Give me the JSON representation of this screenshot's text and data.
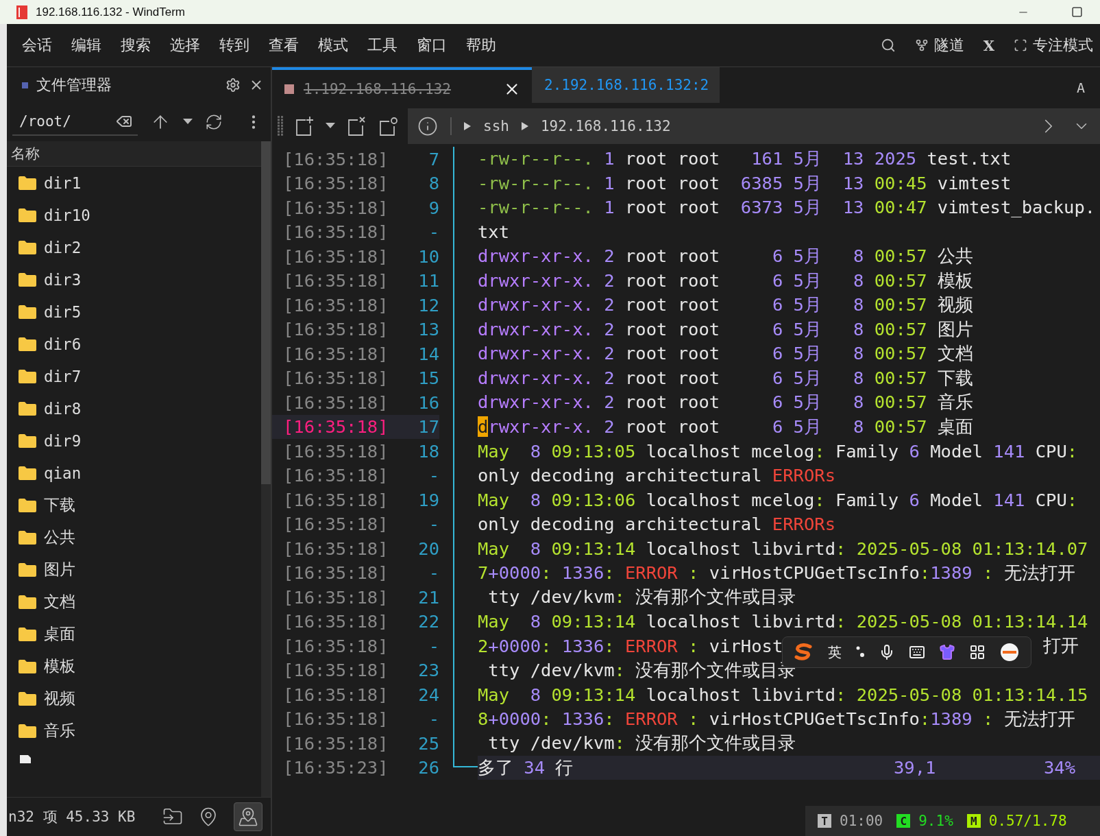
{
  "window": {
    "title": "192.168.116.132 - WindTerm"
  },
  "menu": [
    "会话",
    "编辑",
    "搜索",
    "选择",
    "转到",
    "查看",
    "模式",
    "工具",
    "窗口",
    "帮助"
  ],
  "menu_right": {
    "tunnel": "隧道",
    "x": "X",
    "focus": "专注模式"
  },
  "file_manager": {
    "title": "文件管理器",
    "path": "/root/",
    "column": "名称",
    "items": [
      {
        "kind": "folder",
        "name": "dir1"
      },
      {
        "kind": "folder",
        "name": "dir10"
      },
      {
        "kind": "folder",
        "name": "dir2"
      },
      {
        "kind": "folder",
        "name": "dir3"
      },
      {
        "kind": "folder",
        "name": "dir5"
      },
      {
        "kind": "folder",
        "name": "dir6"
      },
      {
        "kind": "folder",
        "name": "dir7"
      },
      {
        "kind": "folder",
        "name": "dir8"
      },
      {
        "kind": "folder",
        "name": "dir9"
      },
      {
        "kind": "folder",
        "name": "qian"
      },
      {
        "kind": "folder",
        "name": "下载"
      },
      {
        "kind": "folder",
        "name": "公共"
      },
      {
        "kind": "folder",
        "name": "图片"
      },
      {
        "kind": "folder",
        "name": "文档"
      },
      {
        "kind": "folder",
        "name": "桌面"
      },
      {
        "kind": "folder",
        "name": "模板"
      },
      {
        "kind": "folder",
        "name": "视频"
      },
      {
        "kind": "folder",
        "name": "音乐"
      },
      {
        "kind": "file"
      }
    ],
    "footer": "n32 项 45.33 KB",
    "footer_buttons": [
      {
        "kind": "open",
        "selected": false
      },
      {
        "kind": "locate",
        "selected": false
      },
      {
        "kind": "follow",
        "selected": true
      }
    ]
  },
  "tabs": [
    {
      "label": "1.192.168.116.132",
      "selected": true,
      "disconnected": true
    },
    {
      "label": "2.192.168.116.132:2",
      "selected": false,
      "disconnected": false
    }
  ],
  "tab_bar_right": "A",
  "breadcrumb": [
    "ssh",
    "192.168.116.132"
  ],
  "terminal": {
    "rows": [
      {
        "time": "[16:35:18]",
        "num": "7",
        "current": false,
        "segs": [
          {
            "text": "-rw-r--r--.",
            "kind": "fperm"
          },
          {
            "text": " 1",
            "kind": "num"
          },
          {
            "text": " root root",
            "kind": "plain"
          },
          {
            "text": "   161 5月  13 2025",
            "kind": "num"
          },
          {
            "text": " test.txt",
            "kind": "plain"
          }
        ]
      },
      {
        "time": "[16:35:18]",
        "num": "8",
        "current": false,
        "segs": [
          {
            "text": "-rw-r--r--.",
            "kind": "fperm"
          },
          {
            "text": " 1",
            "kind": "num"
          },
          {
            "text": " root root",
            "kind": "plain"
          },
          {
            "text": "  6385 5月  13",
            "kind": "num"
          },
          {
            "text": " 00:45",
            "kind": "lime"
          },
          {
            "text": " vimtest",
            "kind": "plain"
          }
        ]
      },
      {
        "time": "[16:35:18]",
        "num": "9",
        "current": false,
        "segs": [
          {
            "text": "-rw-r--r--.",
            "kind": "fperm"
          },
          {
            "text": " 1",
            "kind": "num"
          },
          {
            "text": " root root",
            "kind": "plain"
          },
          {
            "text": "  6373 5月  13",
            "kind": "num"
          },
          {
            "text": " 00:47",
            "kind": "lime"
          },
          {
            "text": " vimtest_backup.",
            "kind": "plain"
          }
        ]
      },
      {
        "time": "[16:35:18]",
        "num": "-",
        "current": false,
        "segs": [
          {
            "text": "txt",
            "kind": "plain"
          }
        ]
      },
      {
        "time": "[16:35:18]",
        "num": "10",
        "current": false,
        "segs": [
          {
            "text": "drwxr-xr-x.",
            "kind": "dperm"
          },
          {
            "text": " 2",
            "kind": "num"
          },
          {
            "text": " root root",
            "kind": "plain"
          },
          {
            "text": "     6 5月   8",
            "kind": "num"
          },
          {
            "text": " 00:57",
            "kind": "lime"
          },
          {
            "text": " 公共",
            "kind": "plain"
          }
        ]
      },
      {
        "time": "[16:35:18]",
        "num": "11",
        "current": false,
        "segs": [
          {
            "text": "drwxr-xr-x.",
            "kind": "dperm"
          },
          {
            "text": " 2",
            "kind": "num"
          },
          {
            "text": " root root",
            "kind": "plain"
          },
          {
            "text": "     6 5月   8",
            "kind": "num"
          },
          {
            "text": " 00:57",
            "kind": "lime"
          },
          {
            "text": " 模板",
            "kind": "plain"
          }
        ]
      },
      {
        "time": "[16:35:18]",
        "num": "12",
        "current": false,
        "segs": [
          {
            "text": "drwxr-xr-x.",
            "kind": "dperm"
          },
          {
            "text": " 2",
            "kind": "num"
          },
          {
            "text": " root root",
            "kind": "plain"
          },
          {
            "text": "     6 5月   8",
            "kind": "num"
          },
          {
            "text": " 00:57",
            "kind": "lime"
          },
          {
            "text": " 视频",
            "kind": "plain"
          }
        ]
      },
      {
        "time": "[16:35:18]",
        "num": "13",
        "current": false,
        "segs": [
          {
            "text": "drwxr-xr-x.",
            "kind": "dperm"
          },
          {
            "text": " 2",
            "kind": "num"
          },
          {
            "text": " root root",
            "kind": "plain"
          },
          {
            "text": "     6 5月   8",
            "kind": "num"
          },
          {
            "text": " 00:57",
            "kind": "lime"
          },
          {
            "text": " 图片",
            "kind": "plain"
          }
        ]
      },
      {
        "time": "[16:35:18]",
        "num": "14",
        "current": false,
        "segs": [
          {
            "text": "drwxr-xr-x.",
            "kind": "dperm"
          },
          {
            "text": " 2",
            "kind": "num"
          },
          {
            "text": " root root",
            "kind": "plain"
          },
          {
            "text": "     6 5月   8",
            "kind": "num"
          },
          {
            "text": " 00:57",
            "kind": "lime"
          },
          {
            "text": " 文档",
            "kind": "plain"
          }
        ]
      },
      {
        "time": "[16:35:18]",
        "num": "15",
        "current": false,
        "segs": [
          {
            "text": "drwxr-xr-x.",
            "kind": "dperm"
          },
          {
            "text": " 2",
            "kind": "num"
          },
          {
            "text": " root root",
            "kind": "plain"
          },
          {
            "text": "     6 5月   8",
            "kind": "num"
          },
          {
            "text": " 00:57",
            "kind": "lime"
          },
          {
            "text": " 下载",
            "kind": "plain"
          }
        ]
      },
      {
        "time": "[16:35:18]",
        "num": "16",
        "current": false,
        "segs": [
          {
            "text": "drwxr-xr-x.",
            "kind": "dperm"
          },
          {
            "text": " 2",
            "kind": "num"
          },
          {
            "text": " root root",
            "kind": "plain"
          },
          {
            "text": "     6 5月   8",
            "kind": "num"
          },
          {
            "text": " 00:57",
            "kind": "lime"
          },
          {
            "text": " 音乐",
            "kind": "plain"
          }
        ]
      },
      {
        "time": "[16:35:18]",
        "num": "17",
        "current": true,
        "segs": [
          {
            "text": "d",
            "kind": "cursor"
          },
          {
            "text": "rwxr-xr-x.",
            "kind": "dperm"
          },
          {
            "text": " 2",
            "kind": "num"
          },
          {
            "text": " root root",
            "kind": "plain"
          },
          {
            "text": "     6 5月   8",
            "kind": "num"
          },
          {
            "text": " 00:57",
            "kind": "lime"
          },
          {
            "text": " 桌面",
            "kind": "plain"
          }
        ]
      },
      {
        "time": "[16:35:18]",
        "num": "18",
        "current": false,
        "segs": [
          {
            "text": "May",
            "kind": "lime"
          },
          {
            "text": "  8",
            "kind": "num"
          },
          {
            "text": " 09:13:05",
            "kind": "lime"
          },
          {
            "text": " localhost mcelog",
            "kind": "plain"
          },
          {
            "text": ":",
            "kind": "lime"
          },
          {
            "text": " Family",
            "kind": "plain"
          },
          {
            "text": " 6",
            "kind": "num"
          },
          {
            "text": " Model",
            "kind": "plain"
          },
          {
            "text": " 141",
            "kind": "num"
          },
          {
            "text": " CPU",
            "kind": "plain"
          },
          {
            "text": ":",
            "kind": "lime"
          }
        ]
      },
      {
        "time": "[16:35:18]",
        "num": "-",
        "current": false,
        "segs": [
          {
            "text": "only decoding architectural",
            "kind": "plain"
          },
          {
            "text": " ERRORs",
            "kind": "error"
          }
        ]
      },
      {
        "time": "[16:35:18]",
        "num": "19",
        "current": false,
        "segs": [
          {
            "text": "May",
            "kind": "lime"
          },
          {
            "text": "  8",
            "kind": "num"
          },
          {
            "text": " 09:13:06",
            "kind": "lime"
          },
          {
            "text": " localhost mcelog",
            "kind": "plain"
          },
          {
            "text": ":",
            "kind": "lime"
          },
          {
            "text": " Family",
            "kind": "plain"
          },
          {
            "text": " 6",
            "kind": "num"
          },
          {
            "text": " Model",
            "kind": "plain"
          },
          {
            "text": " 141",
            "kind": "num"
          },
          {
            "text": " CPU",
            "kind": "plain"
          },
          {
            "text": ":",
            "kind": "lime"
          }
        ]
      },
      {
        "time": "[16:35:18]",
        "num": "-",
        "current": false,
        "segs": [
          {
            "text": "only decoding architectural",
            "kind": "plain"
          },
          {
            "text": " ERRORs",
            "kind": "error"
          }
        ]
      },
      {
        "time": "[16:35:18]",
        "num": "20",
        "current": false,
        "segs": [
          {
            "text": "May",
            "kind": "lime"
          },
          {
            "text": "  8",
            "kind": "num"
          },
          {
            "text": " 09:13:14",
            "kind": "lime"
          },
          {
            "text": " localhost libvirtd",
            "kind": "plain"
          },
          {
            "text": ": 2025-05-08 01:13:14.07",
            "kind": "lime"
          }
        ]
      },
      {
        "time": "[16:35:18]",
        "num": "-",
        "current": false,
        "segs": [
          {
            "text": "7",
            "kind": "lime"
          },
          {
            "text": "+0000",
            "kind": "num"
          },
          {
            "text": ":",
            "kind": "lime"
          },
          {
            "text": " 1336",
            "kind": "num"
          },
          {
            "text": ":",
            "kind": "lime"
          },
          {
            "text": " ERROR",
            "kind": "error"
          },
          {
            "text": " :",
            "kind": "lime"
          },
          {
            "text": " virHostCPUGetTscInfo",
            "kind": "plain"
          },
          {
            "text": ":",
            "kind": "lime"
          },
          {
            "text": "1389",
            "kind": "num"
          },
          {
            "text": " :",
            "kind": "lime"
          },
          {
            "text": " 无法打开",
            "kind": "plain"
          }
        ]
      },
      {
        "time": "[16:35:18]",
        "num": "21",
        "current": false,
        "segs": [
          {
            "text": " tty /dev/kvm",
            "kind": "plain"
          },
          {
            "text": ":",
            "kind": "lime"
          },
          {
            "text": " 没有那个文件或目录",
            "kind": "plain"
          }
        ]
      },
      {
        "time": "[16:35:18]",
        "num": "22",
        "current": false,
        "segs": [
          {
            "text": "May",
            "kind": "lime"
          },
          {
            "text": "  8",
            "kind": "num"
          },
          {
            "text": " 09:13:14",
            "kind": "lime"
          },
          {
            "text": " localhost libvirtd",
            "kind": "plain"
          },
          {
            "text": ": 2025-05-08 01:13:14.14",
            "kind": "lime"
          }
        ]
      },
      {
        "time": "[16:35:18]",
        "num": "-",
        "current": false,
        "segs": [
          {
            "text": "2",
            "kind": "lime"
          },
          {
            "text": "+0000",
            "kind": "num"
          },
          {
            "text": ":",
            "kind": "lime"
          },
          {
            "text": " 1336",
            "kind": "num"
          },
          {
            "text": ":",
            "kind": "lime"
          },
          {
            "text": " ERROR",
            "kind": "error"
          },
          {
            "text": " :",
            "kind": "lime"
          },
          {
            "text": " virHost",
            "kind": "plain"
          },
          {
            "text": "打开",
            "kind": "tail"
          }
        ]
      },
      {
        "time": "[16:35:18]",
        "num": "23",
        "current": false,
        "segs": [
          {
            "text": " tty /dev/kvm",
            "kind": "plain"
          },
          {
            "text": ":",
            "kind": "lime"
          },
          {
            "text": " 没有那个文件或目录",
            "kind": "plain"
          }
        ]
      },
      {
        "time": "[16:35:18]",
        "num": "24",
        "current": false,
        "segs": [
          {
            "text": "May",
            "kind": "lime"
          },
          {
            "text": "  8",
            "kind": "num"
          },
          {
            "text": " 09:13:14",
            "kind": "lime"
          },
          {
            "text": " localhost libvirtd",
            "kind": "plain"
          },
          {
            "text": ": 2025-05-08 01:13:14.15",
            "kind": "lime"
          }
        ]
      },
      {
        "time": "[16:35:18]",
        "num": "-",
        "current": false,
        "segs": [
          {
            "text": "8",
            "kind": "lime"
          },
          {
            "text": "+0000",
            "kind": "num"
          },
          {
            "text": ":",
            "kind": "lime"
          },
          {
            "text": " 1336",
            "kind": "num"
          },
          {
            "text": ":",
            "kind": "lime"
          },
          {
            "text": " ERROR",
            "kind": "error"
          },
          {
            "text": " :",
            "kind": "lime"
          },
          {
            "text": " virHostCPUGetTscInfo",
            "kind": "plain"
          },
          {
            "text": ":",
            "kind": "lime"
          },
          {
            "text": "1389",
            "kind": "num"
          },
          {
            "text": " :",
            "kind": "lime"
          },
          {
            "text": " 无法打开",
            "kind": "plain"
          }
        ]
      },
      {
        "time": "[16:35:18]",
        "num": "25",
        "current": false,
        "segs": [
          {
            "text": " tty /dev/kvm",
            "kind": "plain"
          },
          {
            "text": ":",
            "kind": "lime"
          },
          {
            "text": " 没有那个文件或目录",
            "kind": "plain"
          }
        ]
      }
    ],
    "status_line": {
      "time": "[16:35:23]",
      "num": "26",
      "segs": [
        {
          "text": "多了",
          "kind": "plain"
        },
        {
          "text": " 34",
          "kind": "num"
        },
        {
          "text": " 行",
          "kind": "plain"
        }
      ],
      "ruler": "39,1",
      "percent": "34%"
    }
  },
  "ime": {
    "label": "英"
  },
  "status": [
    {
      "kind": "time",
      "badge": "T",
      "value": "01:00"
    },
    {
      "kind": "cpu",
      "badge": "C",
      "value": "9.1%"
    },
    {
      "kind": "mem",
      "badge": "M",
      "value": "0.57/1.78"
    }
  ]
}
